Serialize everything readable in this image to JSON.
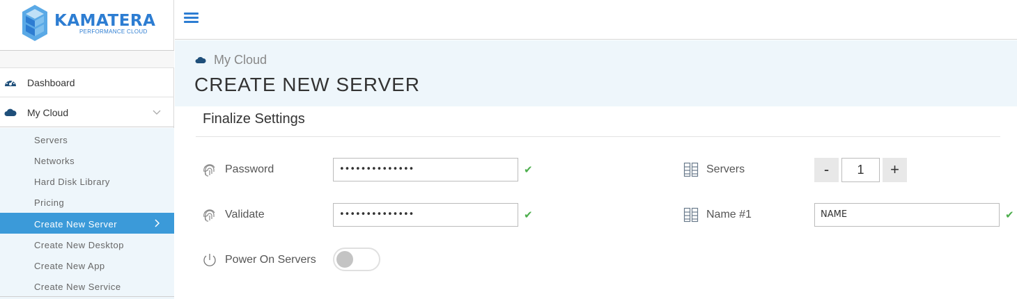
{
  "brand": {
    "name": "KAMATERA",
    "tagline": "PERFORMANCE CLOUD",
    "color": "#2d7dd2"
  },
  "sidebar": {
    "items": [
      {
        "label": "Dashboard",
        "icon": "dashboard-gauge-icon"
      },
      {
        "label": "My Cloud",
        "icon": "cloud-icon",
        "expanded": true
      }
    ],
    "submenu": [
      {
        "label": "Servers"
      },
      {
        "label": "Networks"
      },
      {
        "label": "Hard Disk Library"
      },
      {
        "label": "Pricing"
      },
      {
        "label": "Create New Server",
        "active": true
      },
      {
        "label": "Create New Desktop"
      },
      {
        "label": "Create New App"
      },
      {
        "label": "Create New Service"
      }
    ],
    "active_color": "#3b9ad9"
  },
  "topbar": {
    "menu_icon": "hamburger-menu-icon"
  },
  "header": {
    "breadcrumb": "My Cloud",
    "title": "CREATE NEW SERVER"
  },
  "form": {
    "section_title": "Finalize Settings",
    "password": {
      "label": "Password",
      "value": "••••••••••••••",
      "valid": true
    },
    "validate": {
      "label": "Validate",
      "value": "••••••••••••••",
      "valid": true
    },
    "power_on": {
      "label": "Power On Servers",
      "enabled": false
    },
    "servers": {
      "label": "Servers",
      "minus": "-",
      "count": "1",
      "plus": "+"
    },
    "name": {
      "label": "Name #1",
      "value": "NAME",
      "valid": true
    }
  },
  "check_color": "#4cae4c"
}
